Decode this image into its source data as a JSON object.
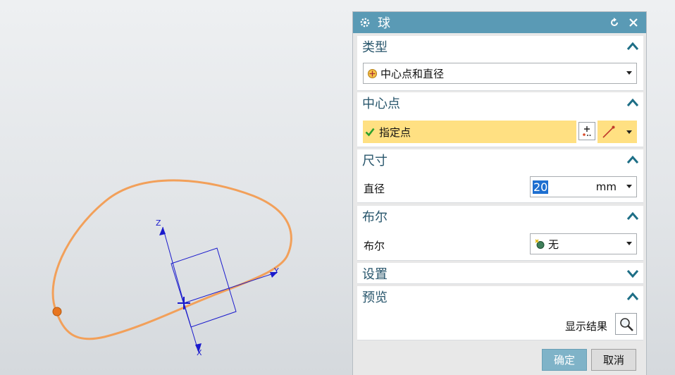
{
  "viewport": {
    "axes": {
      "z": "Z",
      "x": "X",
      "y": "Y"
    }
  },
  "dialog": {
    "title": "球",
    "icons": [
      "gear-icon",
      "reset-icon",
      "close-icon"
    ],
    "sections": {
      "type": {
        "title": "类型",
        "expanded": true,
        "value": "中心点和直径"
      },
      "center": {
        "title": "中心点",
        "expanded": true,
        "point_label": "指定点",
        "status": "specified"
      },
      "dimensions": {
        "title": "尺寸",
        "expanded": true,
        "field_label": "直径",
        "value": "20",
        "unit": "mm"
      },
      "boolean": {
        "title": "布尔",
        "expanded": true,
        "field_label": "布尔",
        "value": "无"
      },
      "settings": {
        "title": "设置",
        "expanded": false
      },
      "preview": {
        "title": "预览",
        "expanded": true,
        "show_result_label": "显示结果"
      }
    },
    "buttons": {
      "ok": "确定",
      "cancel": "取消"
    }
  },
  "colors": {
    "title_bar": "#5a9ab5",
    "section_header_text": "#27556b",
    "highlight": "#ffe082",
    "curve": "#f2a05a",
    "axes": "#1a1acc",
    "ok_button": "#7fb3c8"
  }
}
